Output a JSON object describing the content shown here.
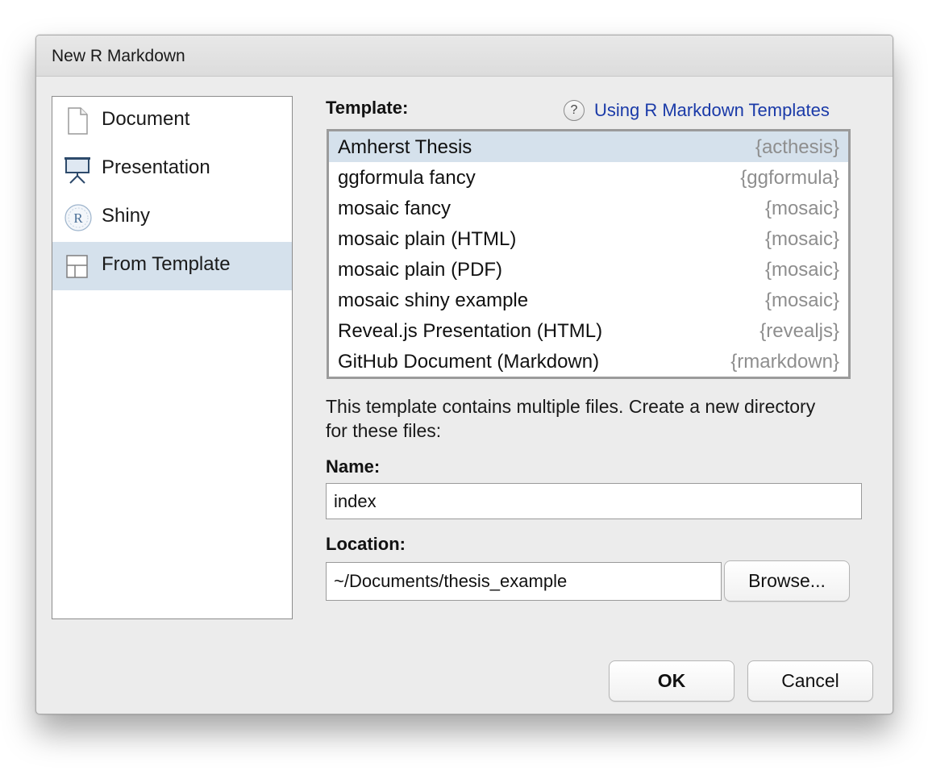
{
  "window": {
    "title": "New R Markdown"
  },
  "sidebar": {
    "items": [
      {
        "label": "Document",
        "icon": "document-icon",
        "selected": false
      },
      {
        "label": "Presentation",
        "icon": "presentation-icon",
        "selected": false
      },
      {
        "label": "Shiny",
        "icon": "shiny-icon",
        "selected": false
      },
      {
        "label": "From Template",
        "icon": "template-icon",
        "selected": true
      }
    ]
  },
  "template_section": {
    "label": "Template:",
    "help_link": "Using R Markdown Templates",
    "help_icon": "?",
    "templates": [
      {
        "name": "Amherst Thesis",
        "package": "{acthesis}",
        "selected": true
      },
      {
        "name": "ggformula fancy",
        "package": "{ggformula}",
        "selected": false
      },
      {
        "name": "mosaic fancy",
        "package": "{mosaic}",
        "selected": false
      },
      {
        "name": "mosaic plain (HTML)",
        "package": "{mosaic}",
        "selected": false
      },
      {
        "name": "mosaic plain (PDF)",
        "package": "{mosaic}",
        "selected": false
      },
      {
        "name": "mosaic shiny example",
        "package": "{mosaic}",
        "selected": false
      },
      {
        "name": "Reveal.js Presentation (HTML)",
        "package": "{revealjs}",
        "selected": false
      },
      {
        "name": "GitHub Document (Markdown)",
        "package": "{rmarkdown}",
        "selected": false
      }
    ]
  },
  "description": "This template contains multiple files. Create a new directory for these files:",
  "name_field": {
    "label": "Name:",
    "value": "index"
  },
  "location_field": {
    "label": "Location:",
    "value": "~/Documents/thesis_example",
    "browse_label": "Browse..."
  },
  "buttons": {
    "ok": "OK",
    "cancel": "Cancel"
  },
  "colors": {
    "selection": "#d5e1ec",
    "link": "#1a3aa8",
    "package_text": "#8e8e8e"
  }
}
